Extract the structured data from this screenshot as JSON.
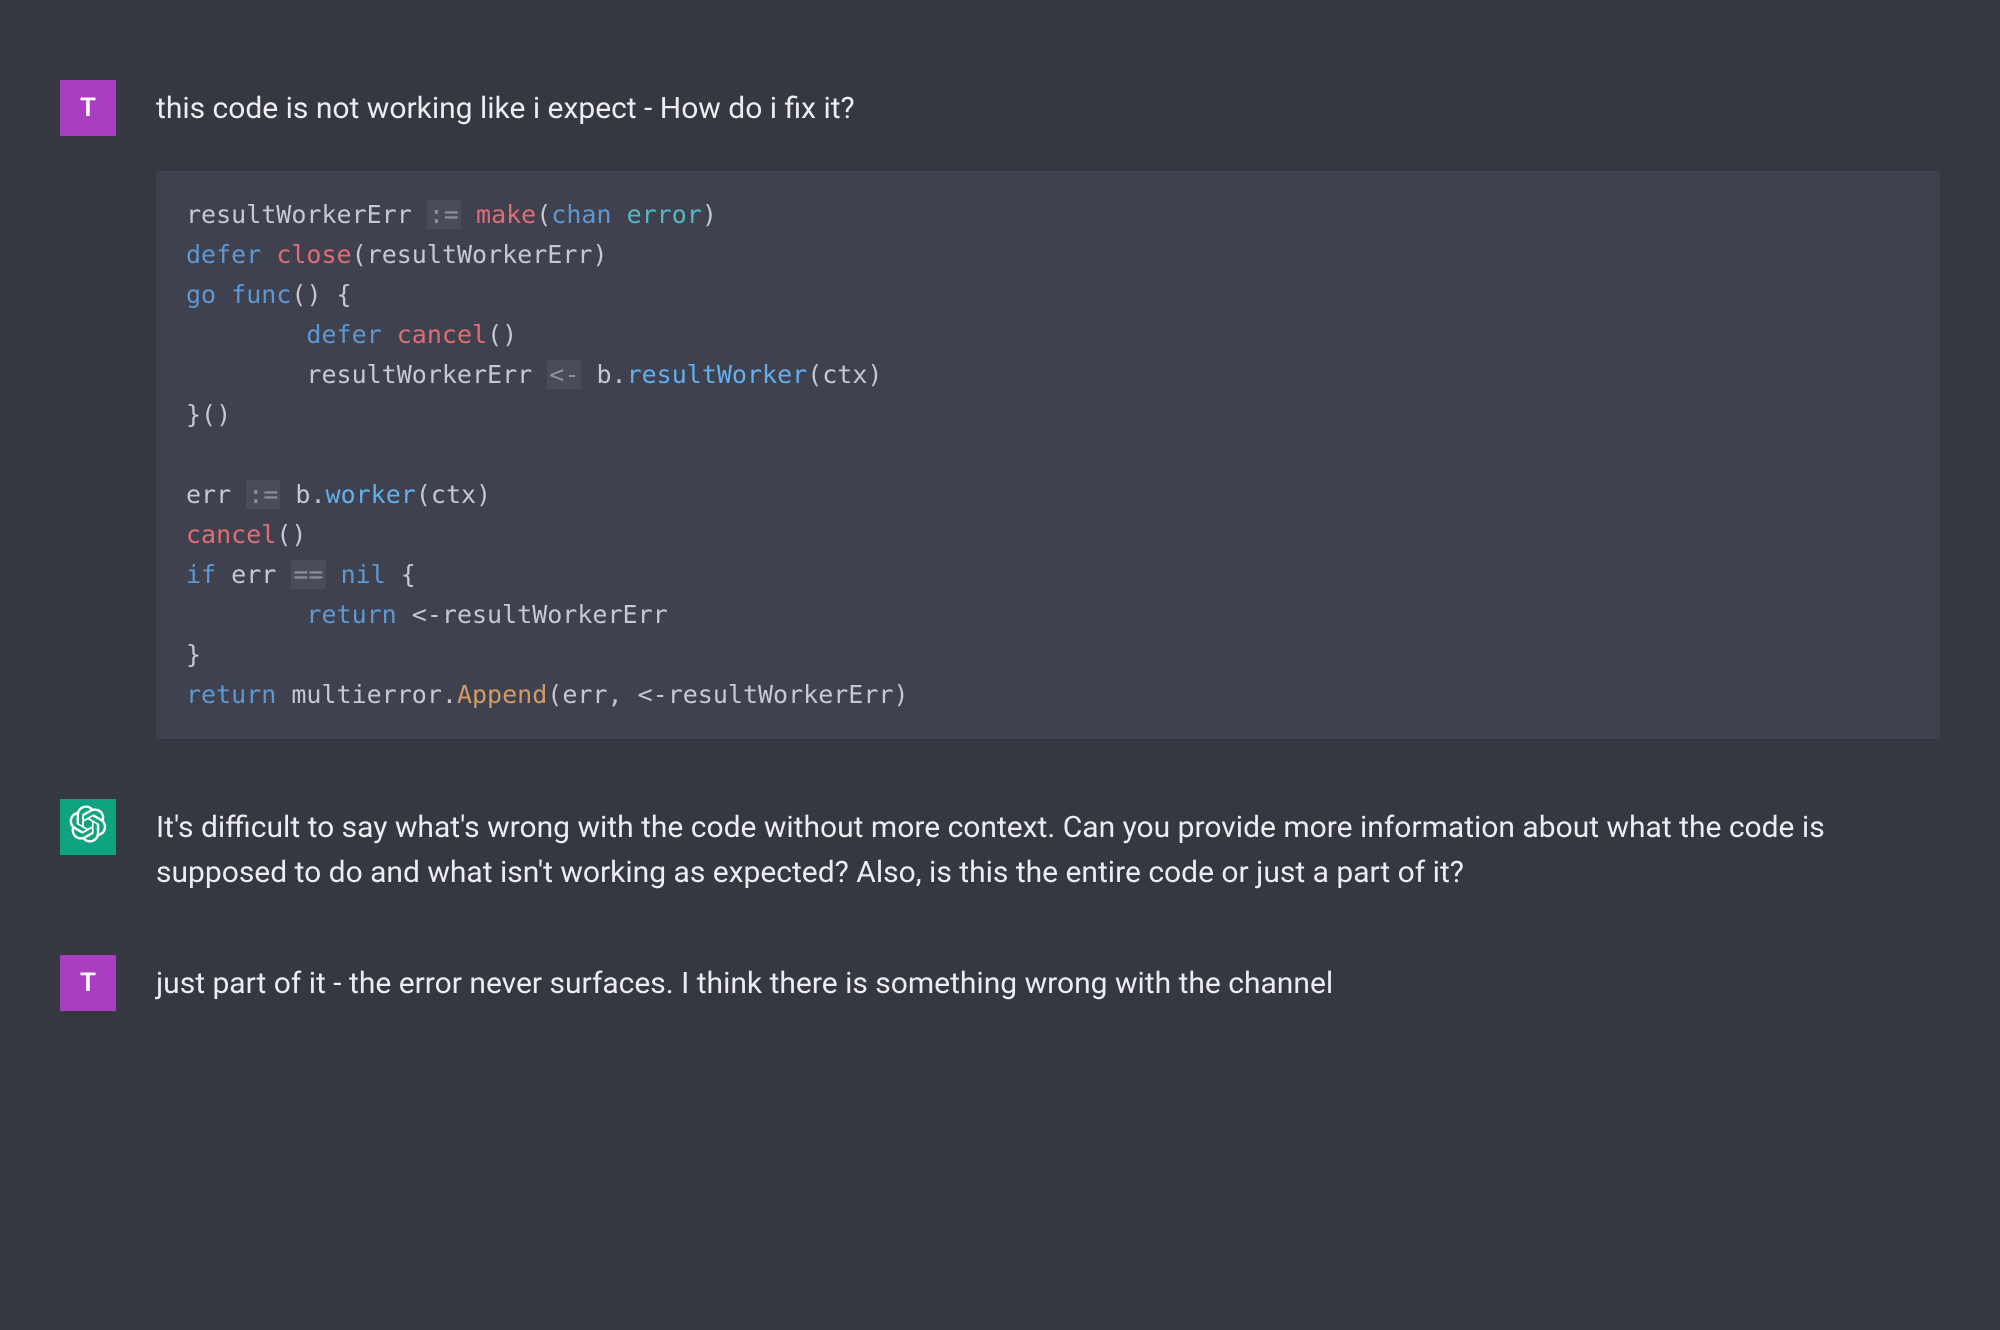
{
  "conversation": {
    "messages": [
      {
        "role": "user",
        "avatar_letter": "T",
        "text": "this code is not working like i expect - How do i fix it?"
      },
      {
        "role": "assistant",
        "text": "It's difficult to say what's wrong with the code without more context. Can you provide more information about what the code is supposed to do and what isn't working as expected? Also, is this the entire code or just a part of it?"
      },
      {
        "role": "user",
        "avatar_letter": "T",
        "text": "just part of it - the error never surfaces. I think there is something wrong with the channel"
      }
    ]
  },
  "code": {
    "language": "go",
    "tokens": {
      "l1_var": "resultWorkerErr",
      "l1_walrus": ":=",
      "l1_make": "make",
      "l1_chan": "chan",
      "l1_error": "error",
      "l2_defer": "defer",
      "l2_close": "close",
      "l2_arg": "resultWorkerErr",
      "l3_go": "go",
      "l3_func": "func",
      "l4_defer": "defer",
      "l4_cancel": "cancel",
      "l5_target": "resultWorkerErr",
      "l5_send": "<-",
      "l5_b": "b",
      "l5_method": "resultWorker",
      "l5_arg": "ctx",
      "l8_err": "err",
      "l8_walrus": ":=",
      "l8_b": "b",
      "l8_method": "worker",
      "l8_arg": "ctx",
      "l9_cancel": "cancel",
      "l10_if": "if",
      "l10_err": "err",
      "l10_eq": "==",
      "l10_nil": "nil",
      "l11_return": "return",
      "l11_recv": "<-resultWorkerErr",
      "l13_return": "return",
      "l13_pkg": "multierror",
      "l13_method": "Append",
      "l13_err": "err",
      "l13_recv": "<-resultWorkerErr"
    }
  },
  "colors": {
    "background": "#353741",
    "code_background": "#40414f",
    "user_avatar": "#a93ec3",
    "assistant_avatar": "#10a37f",
    "text": "#ececf1"
  }
}
